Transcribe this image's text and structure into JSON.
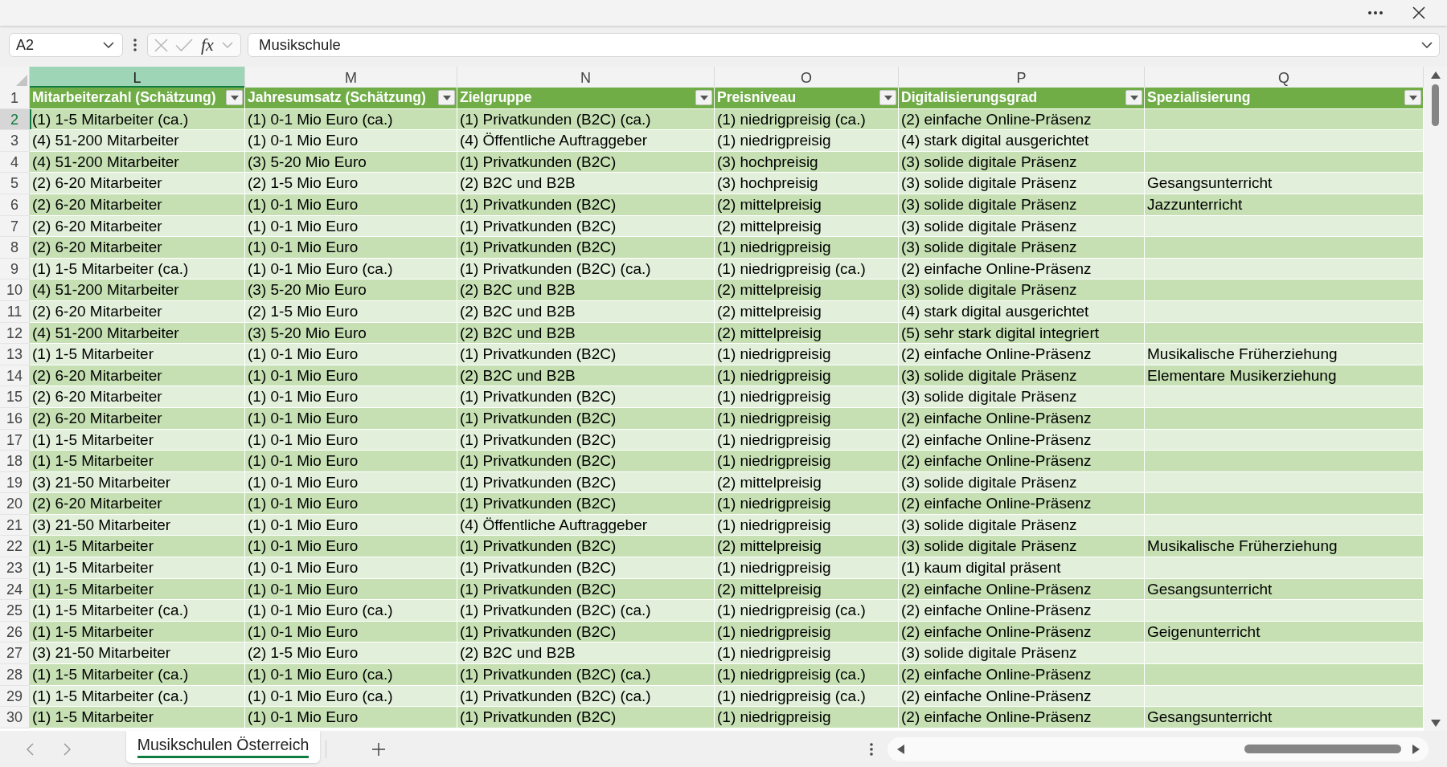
{
  "formula_bar": {
    "name_box": "A2",
    "buttons": [
      {
        "kind": "cancel",
        "disabled": true
      },
      {
        "kind": "enter",
        "disabled": true
      },
      {
        "kind": "function",
        "label": "fx",
        "disabled": false
      }
    ],
    "value": "Musikschule"
  },
  "sheet": {
    "columns": [
      {
        "letter": "L",
        "selected": true,
        "heading": "Mitarbeiterzahl (Schätzung)"
      },
      {
        "letter": "M",
        "selected": false,
        "heading": "Jahresumsatz (Schätzung)"
      },
      {
        "letter": "N",
        "selected": false,
        "heading": "Zielgruppe"
      },
      {
        "letter": "O",
        "selected": false,
        "heading": "Preisniveau"
      },
      {
        "letter": "P",
        "selected": false,
        "heading": "Digitalisierungsgrad"
      },
      {
        "letter": "Q",
        "selected": false,
        "heading": "Spezialisierung"
      }
    ],
    "header_row": "1",
    "rows": [
      {
        "number": "2",
        "selected": true,
        "cells": [
          "(1) 1-5 Mitarbeiter (ca.)",
          "(1) 0-1 Mio Euro (ca.)",
          "(1) Privatkunden (B2C) (ca.)",
          "(1) niedrigpreisig (ca.)",
          "(2) einfache Online-Präsenz"
        ]
      },
      {
        "number": "3",
        "selected": false,
        "cells": [
          "(4) 51-200 Mitarbeiter",
          "(1) 0-1 Mio Euro",
          "(4) Öffentliche Auftraggeber",
          "(1) niedrigpreisig",
          "(4) stark digital ausgerichtet"
        ]
      },
      {
        "number": "4",
        "selected": false,
        "cells": [
          "(4) 51-200 Mitarbeiter",
          "(3) 5-20 Mio Euro",
          "(1) Privatkunden (B2C)",
          "(3) hochpreisig",
          "(3) solide digitale Präsenz"
        ]
      },
      {
        "number": "5",
        "selected": false,
        "cells": [
          "(2) 6-20 Mitarbeiter",
          "(2) 1-5 Mio Euro",
          "(2) B2C und B2B",
          "(3) hochpreisig",
          "(3) solide digitale Präsenz",
          "Gesangsunterricht"
        ]
      },
      {
        "number": "6",
        "selected": false,
        "cells": [
          "(2) 6-20 Mitarbeiter",
          "(1) 0-1 Mio Euro",
          "(1) Privatkunden (B2C)",
          "(2) mittelpreisig",
          "(3) solide digitale Präsenz",
          "Jazzunterricht"
        ]
      },
      {
        "number": "7",
        "selected": false,
        "cells": [
          "(2) 6-20 Mitarbeiter",
          "(1) 0-1 Mio Euro",
          "(1) Privatkunden (B2C)",
          "(2) mittelpreisig",
          "(3) solide digitale Präsenz"
        ]
      },
      {
        "number": "8",
        "selected": false,
        "cells": [
          "(2) 6-20 Mitarbeiter",
          "(1) 0-1 Mio Euro",
          "(1) Privatkunden (B2C)",
          "(1) niedrigpreisig",
          "(3) solide digitale Präsenz"
        ]
      },
      {
        "number": "9",
        "selected": false,
        "cells": [
          "(1) 1-5 Mitarbeiter (ca.)",
          "(1) 0-1 Mio Euro (ca.)",
          "(1) Privatkunden (B2C) (ca.)",
          "(1) niedrigpreisig (ca.)",
          "(2) einfache Online-Präsenz"
        ]
      },
      {
        "number": "10",
        "selected": false,
        "cells": [
          "(4) 51-200 Mitarbeiter",
          "(3) 5-20 Mio Euro",
          "(2) B2C und B2B",
          "(2) mittelpreisig",
          "(3) solide digitale Präsenz"
        ]
      },
      {
        "number": "11",
        "selected": false,
        "cells": [
          "(2) 6-20 Mitarbeiter",
          "(2) 1-5 Mio Euro",
          "(2) B2C und B2B",
          "(2) mittelpreisig",
          "(4) stark digital ausgerichtet"
        ]
      },
      {
        "number": "12",
        "selected": false,
        "cells": [
          "(4) 51-200 Mitarbeiter",
          "(3) 5-20 Mio Euro",
          "(2) B2C und B2B",
          "(2) mittelpreisig",
          "(5) sehr stark digital integriert"
        ]
      },
      {
        "number": "13",
        "selected": false,
        "cells": [
          "(1) 1-5 Mitarbeiter",
          "(1) 0-1 Mio Euro",
          "(1) Privatkunden (B2C)",
          "(1) niedrigpreisig",
          "(2) einfache Online-Präsenz",
          "Musikalische Früherziehung"
        ]
      },
      {
        "number": "14",
        "selected": false,
        "cells": [
          "(2) 6-20 Mitarbeiter",
          "(1) 0-1 Mio Euro",
          "(2) B2C und B2B",
          "(1) niedrigpreisig",
          "(3) solide digitale Präsenz",
          "Elementare Musikerziehung"
        ]
      },
      {
        "number": "15",
        "selected": false,
        "cells": [
          "(2) 6-20 Mitarbeiter",
          "(1) 0-1 Mio Euro",
          "(1) Privatkunden (B2C)",
          "(1) niedrigpreisig",
          "(3) solide digitale Präsenz"
        ]
      },
      {
        "number": "16",
        "selected": false,
        "cells": [
          "(2) 6-20 Mitarbeiter",
          "(1) 0-1 Mio Euro",
          "(1) Privatkunden (B2C)",
          "(1) niedrigpreisig",
          "(2) einfache Online-Präsenz"
        ]
      },
      {
        "number": "17",
        "selected": false,
        "cells": [
          "(1) 1-5 Mitarbeiter",
          "(1) 0-1 Mio Euro",
          "(1) Privatkunden (B2C)",
          "(1) niedrigpreisig",
          "(2) einfache Online-Präsenz"
        ]
      },
      {
        "number": "18",
        "selected": false,
        "cells": [
          "(1) 1-5 Mitarbeiter",
          "(1) 0-1 Mio Euro",
          "(1) Privatkunden (B2C)",
          "(1) niedrigpreisig",
          "(2) einfache Online-Präsenz"
        ]
      },
      {
        "number": "19",
        "selected": false,
        "cells": [
          "(3) 21-50 Mitarbeiter",
          "(1) 0-1 Mio Euro",
          "(1) Privatkunden (B2C)",
          "(2) mittelpreisig",
          "(3) solide digitale Präsenz"
        ]
      },
      {
        "number": "20",
        "selected": false,
        "cells": [
          "(2) 6-20 Mitarbeiter",
          "(1) 0-1 Mio Euro",
          "(1) Privatkunden (B2C)",
          "(1) niedrigpreisig",
          "(2) einfache Online-Präsenz"
        ]
      },
      {
        "number": "21",
        "selected": false,
        "cells": [
          "(3) 21-50 Mitarbeiter",
          "(1) 0-1 Mio Euro",
          "(4) Öffentliche Auftraggeber",
          "(1) niedrigpreisig",
          "(3) solide digitale Präsenz"
        ]
      },
      {
        "number": "22",
        "selected": false,
        "cells": [
          "(1) 1-5 Mitarbeiter",
          "(1) 0-1 Mio Euro",
          "(1) Privatkunden (B2C)",
          "(2) mittelpreisig",
          "(3) solide digitale Präsenz",
          "Musikalische Früherziehung"
        ]
      },
      {
        "number": "23",
        "selected": false,
        "cells": [
          "(1) 1-5 Mitarbeiter",
          "(1) 0-1 Mio Euro",
          "(1) Privatkunden (B2C)",
          "(1) niedrigpreisig",
          "(1) kaum digital präsent"
        ]
      },
      {
        "number": "24",
        "selected": false,
        "cells": [
          "(1) 1-5 Mitarbeiter",
          "(1) 0-1 Mio Euro",
          "(1) Privatkunden (B2C)",
          "(2) mittelpreisig",
          "(2) einfache Online-Präsenz",
          "Gesangsunterricht"
        ]
      },
      {
        "number": "25",
        "selected": false,
        "cells": [
          "(1) 1-5 Mitarbeiter (ca.)",
          "(1) 0-1 Mio Euro (ca.)",
          "(1) Privatkunden (B2C) (ca.)",
          "(1) niedrigpreisig (ca.)",
          "(2) einfache Online-Präsenz"
        ]
      },
      {
        "number": "26",
        "selected": false,
        "cells": [
          "(1) 1-5 Mitarbeiter",
          "(1) 0-1 Mio Euro",
          "(1) Privatkunden (B2C)",
          "(1) niedrigpreisig",
          "(2) einfache Online-Präsenz",
          "Geigenunterricht"
        ]
      },
      {
        "number": "27",
        "selected": false,
        "cells": [
          "(3) 21-50 Mitarbeiter",
          "(2) 1-5 Mio Euro",
          "(2) B2C und B2B",
          "(1) niedrigpreisig",
          "(3) solide digitale Präsenz"
        ]
      },
      {
        "number": "28",
        "selected": false,
        "cells": [
          "(1) 1-5 Mitarbeiter (ca.)",
          "(1) 0-1 Mio Euro (ca.)",
          "(1) Privatkunden (B2C) (ca.)",
          "(1) niedrigpreisig (ca.)",
          "(2) einfache Online-Präsenz"
        ]
      },
      {
        "number": "29",
        "selected": false,
        "cells": [
          "(1) 1-5 Mitarbeiter (ca.)",
          "(1) 0-1 Mio Euro (ca.)",
          "(1) Privatkunden (B2C) (ca.)",
          "(1) niedrigpreisig (ca.)",
          "(2) einfache Online-Präsenz"
        ]
      },
      {
        "number": "30",
        "selected": false,
        "cells": [
          "(1) 1-5 Mitarbeiter",
          "(1) 0-1 Mio Euro",
          "(1) Privatkunden (B2C)",
          "(1) niedrigpreisig",
          "(2) einfache Online-Präsenz",
          "Gesangsunterricht"
        ]
      }
    ]
  },
  "sheet_tabs": [
    {
      "label": "Musikschulen Österreich",
      "selected": true
    }
  ]
}
